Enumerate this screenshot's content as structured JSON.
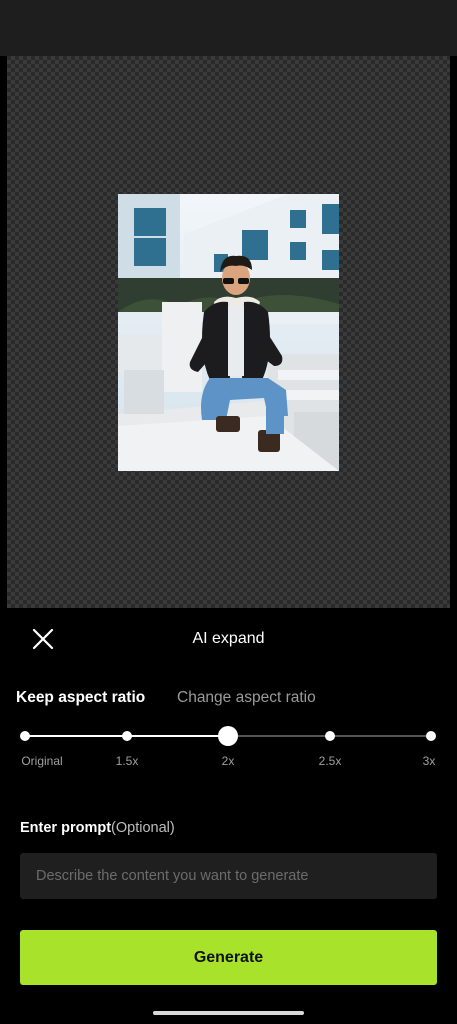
{
  "sheet": {
    "title": "AI expand",
    "tabs": [
      {
        "label": "Keep aspect ratio",
        "selected": true
      },
      {
        "label": "Change aspect ratio",
        "selected": false
      }
    ]
  },
  "scale_slider": {
    "options": [
      "Original",
      "1.5x",
      "2x",
      "2.5x",
      "3x"
    ],
    "selected": "2x"
  },
  "prompt": {
    "label": "Enter prompt",
    "optional_note": "(Optional)",
    "placeholder": "Describe the content you want to generate",
    "value": ""
  },
  "generate_label": "Generate",
  "colors": {
    "accent": "#a8e22a",
    "background": "#000000",
    "input_background": "#1f1f1f"
  },
  "icons": {
    "close": "close-icon"
  }
}
